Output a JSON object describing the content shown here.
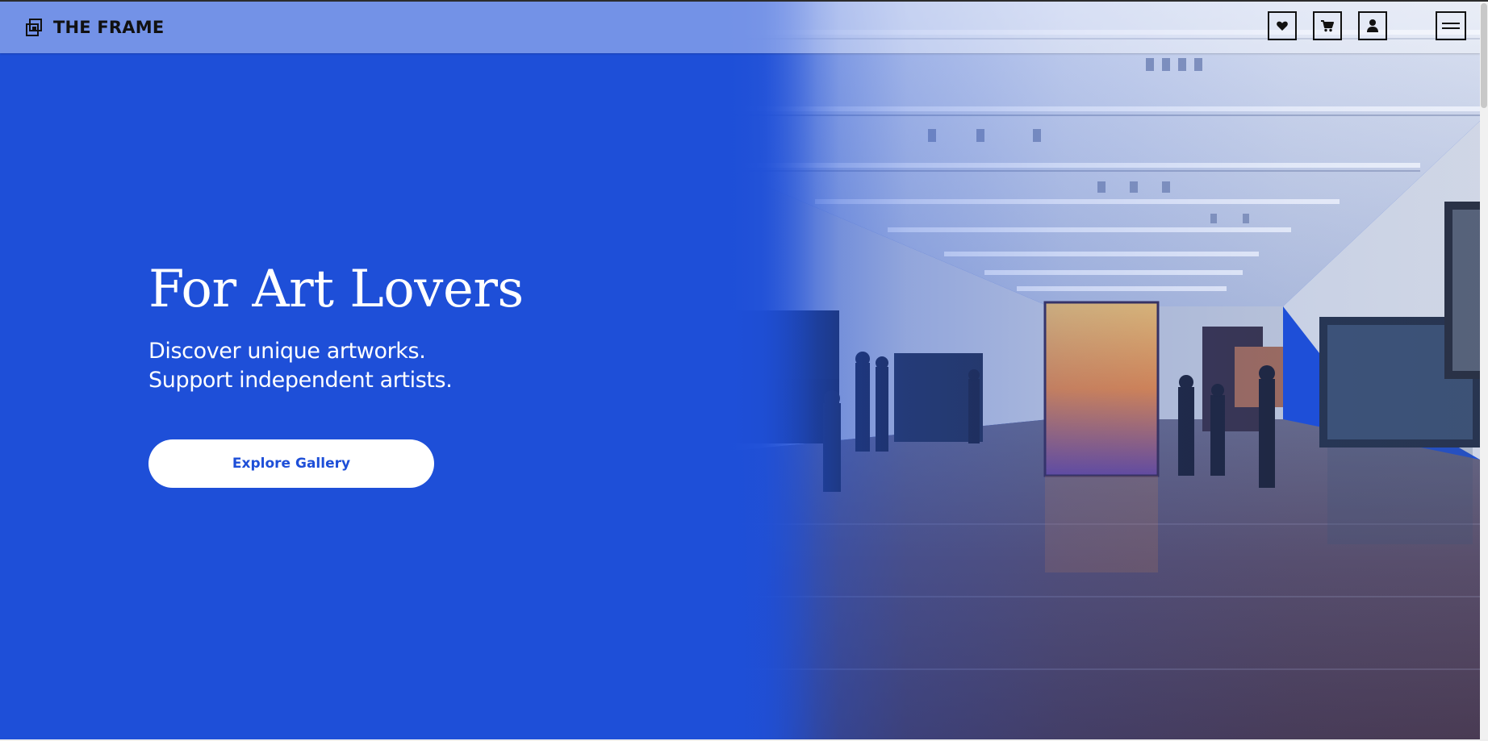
{
  "header": {
    "brand_name": "THE FRAME",
    "icons": {
      "logo": "frame-logo-icon",
      "wishlist": "heart-icon",
      "cart": "cart-icon",
      "account": "user-icon",
      "menu": "hamburger-menu-icon"
    }
  },
  "hero": {
    "title": "For Art Lovers",
    "subtitle_line1": "Discover unique artworks.",
    "subtitle_line2": "Support independent artists.",
    "cta_label": "Explore Gallery",
    "background_image": "art-gallery-interior-photo"
  },
  "colors": {
    "accent": "#1e4fd8",
    "button_bg": "#ffffff",
    "text_light": "#ffffff",
    "text_dark": "#111111"
  }
}
